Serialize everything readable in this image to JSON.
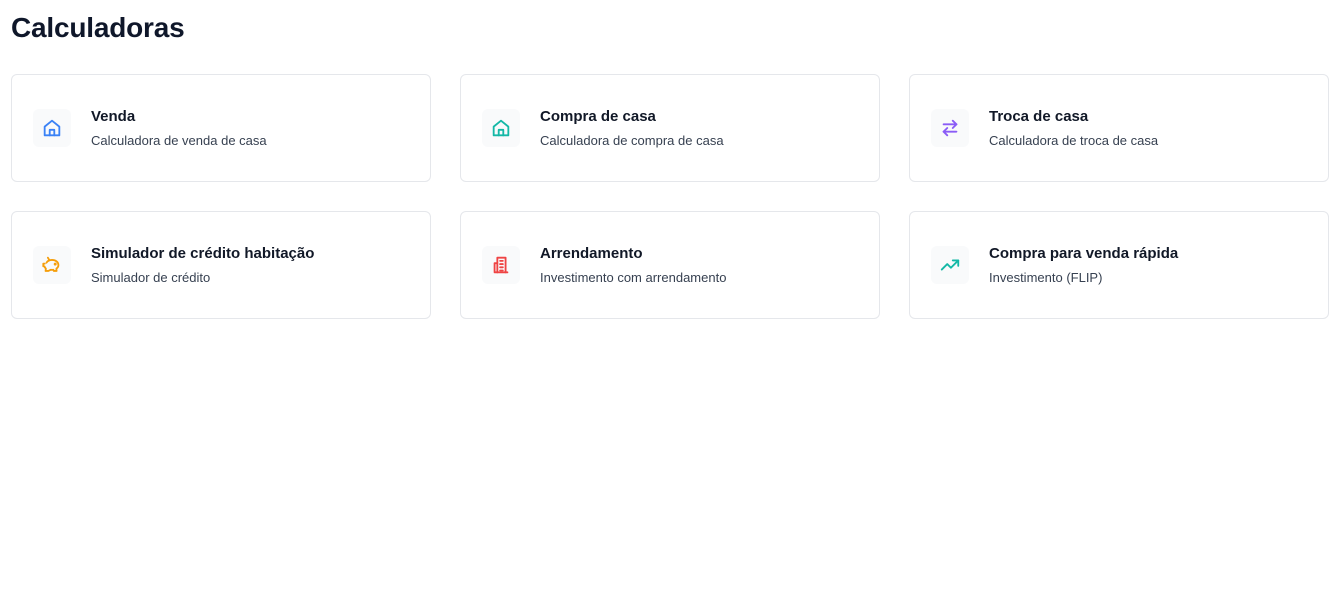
{
  "page": {
    "title": "Calculadoras"
  },
  "cards": [
    {
      "title": "Venda",
      "subtitle": "Calculadora de venda de casa",
      "icon": "home-icon",
      "color": "#3b82f6"
    },
    {
      "title": "Compra de casa",
      "subtitle": "Calculadora de compra de casa",
      "icon": "home-icon",
      "color": "#14b8a6"
    },
    {
      "title": "Troca de casa",
      "subtitle": "Calculadora de troca de casa",
      "icon": "swap-arrows-icon",
      "color": "#8b5cf6"
    },
    {
      "title": "Simulador de crédito habitação",
      "subtitle": "Simulador de crédito",
      "icon": "piggy-bank-icon",
      "color": "#f59e0b"
    },
    {
      "title": "Arrendamento",
      "subtitle": "Investimento com arrendamento",
      "icon": "building-icon",
      "color": "#ef4444"
    },
    {
      "title": "Compra para venda rápida",
      "subtitle": "Investimento (FLIP)",
      "icon": "trending-up-icon",
      "color": "#14b8a6"
    }
  ]
}
